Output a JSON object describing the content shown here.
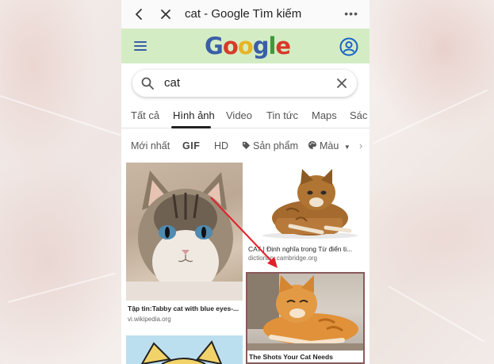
{
  "browser": {
    "title": "cat - Google Tìm kiếm",
    "back_icon": "chevron-left-icon",
    "close_icon": "close-icon",
    "more_icon": "more-dots-icon"
  },
  "google": {
    "logo_text": "Google",
    "menu_icon": "hamburger-menu-icon",
    "account_icon": "account-circle-icon"
  },
  "search": {
    "query": "cat",
    "search_icon": "search-icon",
    "clear_icon": "clear-icon"
  },
  "tabs": [
    {
      "label": "Tất cả"
    },
    {
      "label": "Hình ảnh",
      "active": true
    },
    {
      "label": "Video"
    },
    {
      "label": "Tin tức"
    },
    {
      "label": "Maps"
    },
    {
      "label": "Sác"
    }
  ],
  "filters": [
    {
      "label": "Mới nhất"
    },
    {
      "label": "GIF"
    },
    {
      "label": "HD"
    },
    {
      "label": "Sản phẩm",
      "icon": "tag-icon"
    },
    {
      "label": "Màu",
      "icon": "palette-icon"
    }
  ],
  "results": [
    {
      "caption": "Tập tin:Tabby cat with blue eyes-...",
      "source": "vi.wikipedia.org"
    },
    {
      "caption": "CAT | Định nghĩa trong Từ điển ti...",
      "source": "dictionary.cambridge.org"
    },
    {
      "caption": "The Shots Your Cat Needs",
      "source": ""
    }
  ],
  "colors": {
    "header_bg": "#d4ecc4",
    "annotation_arrow": "#e0202a",
    "accent_blue": "#3b5ea8"
  }
}
